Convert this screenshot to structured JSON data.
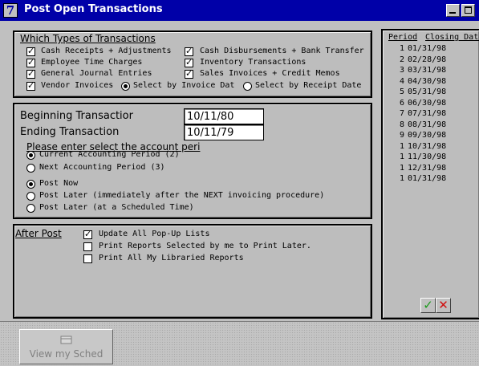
{
  "window": {
    "title": "Post Open Transactions",
    "icon_glyph": "7"
  },
  "types": {
    "heading": "Which Types of Transactions",
    "cash_receipts": "Cash Receipts + Adjustments",
    "cash_disbursements": "Cash Disbursements + Bank Transfer",
    "employee_time": "Employee Time Charges",
    "inventory": "Inventory Transactions",
    "general_journal": "General Journal Entries",
    "sales_invoices": "Sales Invoices + Credit Memos",
    "vendor_invoices": "Vendor Invoices",
    "by_invoice_date": "Select by Invoice Dat",
    "by_receipt_date": "Select by Receipt Date"
  },
  "range": {
    "beginning_label": "Beginning Transactior",
    "beginning_value": "10/11/80",
    "ending_label": "Ending Transaction",
    "ending_value": "10/11/79"
  },
  "period": {
    "prompt": "Please enter select the account peri",
    "current": "Current Accounting Period (2)",
    "next": "Next Accounting Period (3)"
  },
  "post": {
    "now": "Post Now",
    "later_next": "Post Later (immediately after the NEXT invoicing procedure)",
    "later_scheduled": "Post Later (at a Scheduled Time)"
  },
  "after_post": {
    "heading": "After Post",
    "update_lists": "Update All Pop-Up Lists",
    "print_selected": "Print Reports Selected by me to Print Later.",
    "print_libraried": "Print All My Libraried Reports"
  },
  "periods": {
    "col_period": "Period",
    "col_closing": "Closing Date",
    "rows": [
      {
        "period": "1",
        "date": "01/31/98"
      },
      {
        "period": "2",
        "date": "02/28/98"
      },
      {
        "period": "3",
        "date": "03/31/98"
      },
      {
        "period": "4",
        "date": "04/30/98"
      },
      {
        "period": "5",
        "date": "05/31/98"
      },
      {
        "period": "6",
        "date": "06/30/98"
      },
      {
        "period": "7",
        "date": "07/31/98"
      },
      {
        "period": "8",
        "date": "08/31/98"
      },
      {
        "period": "9",
        "date": "09/30/98"
      },
      {
        "period": "1",
        "date": "10/31/98"
      },
      {
        "period": "1",
        "date": "11/30/98"
      },
      {
        "period": "1",
        "date": "12/31/98"
      },
      {
        "period": "1",
        "date": "01/31/98"
      }
    ]
  },
  "actions": {
    "ok_glyph": "✓",
    "cancel_glyph": "✕",
    "ok_color": "#1a9a1a",
    "cancel_color": "#d01010"
  },
  "schedule": {
    "label": "View my Sched"
  }
}
